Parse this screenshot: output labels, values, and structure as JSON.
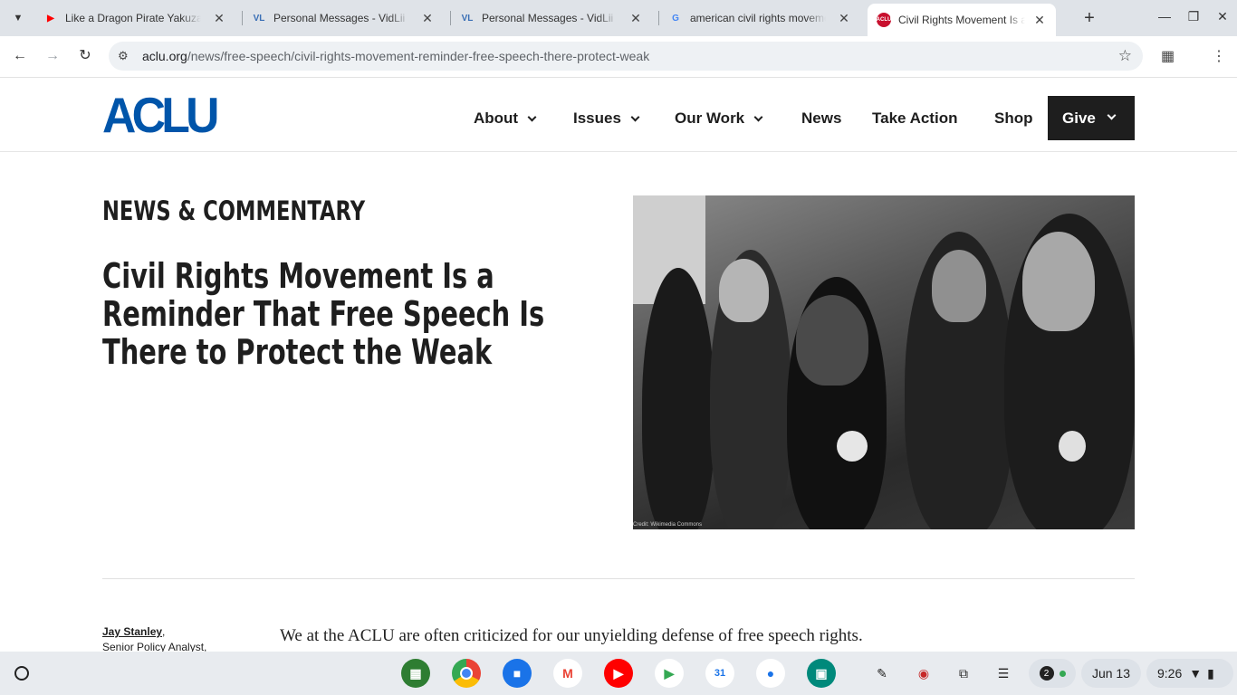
{
  "tabs": [
    {
      "title": "Like a Dragon Pirate Yakuza in Hawaii",
      "favicon": "youtube-icon",
      "color": "#ff0000"
    },
    {
      "title": "Personal Messages - VidLii",
      "favicon": "vidlii-icon",
      "color": "#3a6fb5"
    },
    {
      "title": "Personal Messages - VidLii",
      "favicon": "vidlii-icon",
      "color": "#3a6fb5"
    },
    {
      "title": "american civil rights movement",
      "favicon": "google-icon",
      "color": "#4285f4"
    },
    {
      "title": "Civil Rights Movement Is a Reminder",
      "favicon": "aclu-icon",
      "color": "#c8102e"
    }
  ],
  "browser": {
    "url_host": "aclu.org",
    "url_path": "/news/free-speech/civil-rights-movement-reminder-free-speech-there-protect-weak"
  },
  "site": {
    "logo": "ACLU",
    "nav": [
      "About",
      "Issues",
      "Our Work",
      "News",
      "Take Action",
      "Shop"
    ],
    "give": "Give",
    "brand_color": "#0055aa"
  },
  "article": {
    "kicker": "NEWS & COMMENTARY",
    "headline": "Civil Rights Movement Is a Reminder That Free Speech Is There to Protect the Weak",
    "photo_credit": "Credit: Wikimedia Commons",
    "author_name": "Jay Stanley",
    "author_role": "Senior Policy Analyst,",
    "first_sentence": "We at the ACLU are often criticized for our unyielding defense of free speech rights."
  },
  "shelf": {
    "notification_count": "2",
    "date": "Jun 13",
    "time": "9:26"
  }
}
